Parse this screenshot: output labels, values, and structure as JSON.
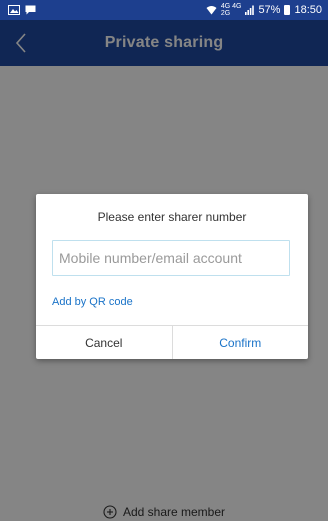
{
  "status_bar": {
    "time": "18:50",
    "battery": "57%",
    "network_top": "4G 4G",
    "network_bottom": "2G"
  },
  "header": {
    "title": "Private sharing"
  },
  "main": {
    "add_member_label": "Add share member"
  },
  "dialog": {
    "title": "Please enter sharer number",
    "input_placeholder": "Mobile number/email account",
    "input_value": "",
    "qr_link": "Add by QR code",
    "cancel_label": "Cancel",
    "confirm_label": "Confirm"
  },
  "colors": {
    "header": "#1f4aa2",
    "status_bar": "#1d3f8e",
    "accent": "#1a73c8"
  }
}
